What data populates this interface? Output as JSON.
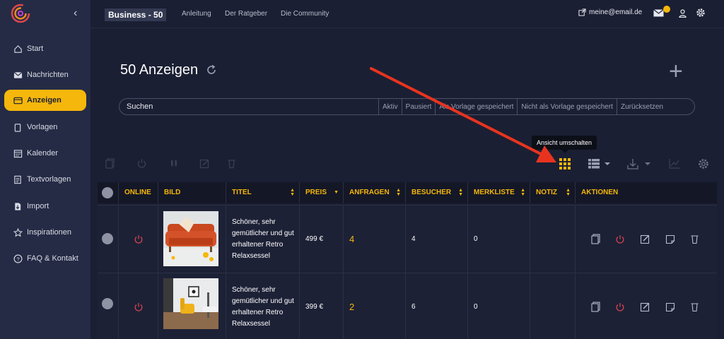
{
  "topbar": {
    "plan": "Business - 50",
    "links": [
      "Anleitung",
      "Der Ratgeber",
      "Die Community"
    ],
    "email": "meine@email.de"
  },
  "sidebar": {
    "items": [
      {
        "label": "Start",
        "icon": "home-icon"
      },
      {
        "label": "Nachrichten",
        "icon": "mail-icon"
      },
      {
        "label": "Anzeigen",
        "icon": "ads-icon",
        "active": true
      },
      {
        "label": "Vorlagen",
        "icon": "template-icon"
      },
      {
        "label": "Kalender",
        "icon": "calendar-icon"
      },
      {
        "label": "Textvorlagen",
        "icon": "text-template-icon"
      },
      {
        "label": "Import",
        "icon": "import-icon"
      },
      {
        "label": "Inspirationen",
        "icon": "star-icon"
      },
      {
        "label": "FAQ & Kontakt",
        "icon": "help-icon"
      }
    ]
  },
  "main": {
    "title": "50 Anzeigen",
    "search_placeholder": "Suchen",
    "filters": [
      "Aktiv",
      "Pausiert",
      "Als Vorlage gespeichert",
      "Nicht als Vorlage gespeichert",
      "Zurücksetzen"
    ],
    "tooltip": "Ansicht umschalten"
  },
  "table": {
    "columns": [
      "ONLINE",
      "BILD",
      "TITEL",
      "PREIS",
      "ANFRAGEN",
      "BESUCHER",
      "MERKLISTE",
      "NOTIZ",
      "AKTIONEN"
    ],
    "rows": [
      {
        "title": "Schöner, sehr gemütlicher und gut erhaltener Retro Relaxsessel",
        "price": "499 €",
        "requests": "4",
        "visitors": "4",
        "watchlist": "0"
      },
      {
        "title": "Schöner, sehr gemütlicher und gut erhaltener Retro Relaxsessel",
        "price": "399 €",
        "requests": "2",
        "visitors": "6",
        "watchlist": "0"
      }
    ]
  },
  "colors": {
    "accent": "#f5b70b",
    "background": "#1b1f33",
    "sidebar": "#252b45",
    "power_red": "#e0474c"
  }
}
